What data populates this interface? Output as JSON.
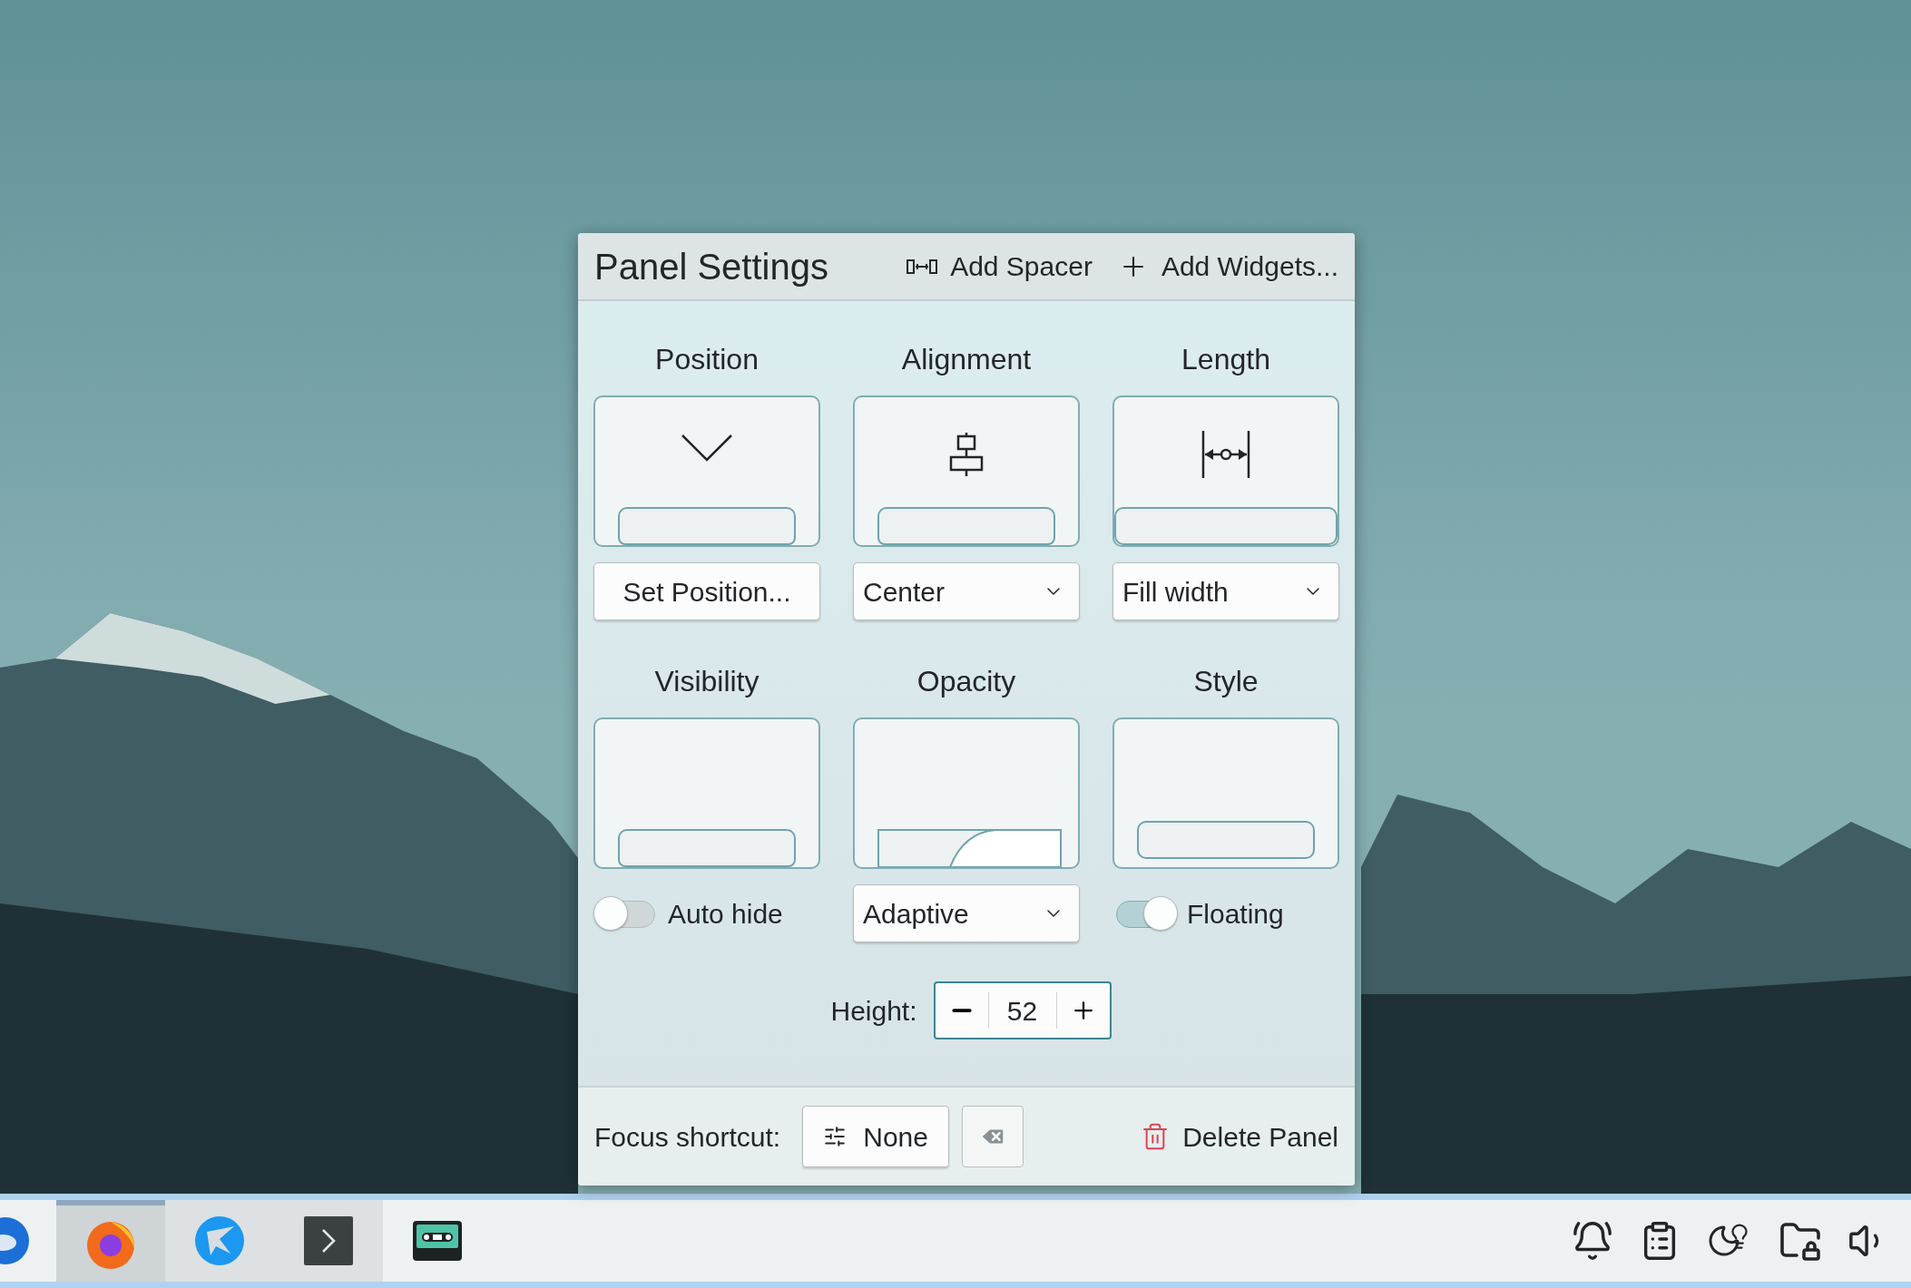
{
  "dialog": {
    "title": "Panel Settings",
    "actions": [
      {
        "kind": "spacer",
        "label": "Add Spacer"
      },
      {
        "kind": "widgets",
        "label": "Add Widgets..."
      }
    ],
    "sections": [
      {
        "label": "Position",
        "kind": "position",
        "control": {
          "kind": "button",
          "text": "Set Position..."
        }
      },
      {
        "label": "Alignment",
        "kind": "alignment",
        "control": {
          "kind": "dropdown",
          "text": "Center"
        }
      },
      {
        "label": "Length",
        "kind": "length",
        "control": {
          "kind": "dropdown",
          "text": "Fill width"
        }
      },
      {
        "label": "Visibility",
        "kind": "visibility",
        "control": {
          "kind": "toggle",
          "text": "Auto hide",
          "on": false
        }
      },
      {
        "label": "Opacity",
        "kind": "opacity",
        "control": {
          "kind": "dropdown",
          "text": "Adaptive"
        }
      },
      {
        "label": "Style",
        "kind": "style",
        "control": {
          "kind": "toggle",
          "text": "Floating",
          "on": true
        }
      }
    ],
    "height": {
      "label": "Height:",
      "value": "52"
    },
    "footer": {
      "label": "Focus shortcut:",
      "shortcut": "None",
      "delete": "Delete Panel"
    }
  },
  "taskbar": {
    "tasks": [
      {
        "kind": "mail",
        "selected": false,
        "running": false
      },
      {
        "kind": "browser",
        "selected": true,
        "running": true
      },
      {
        "kind": "swift",
        "selected": false,
        "running": true
      },
      {
        "kind": "terminal",
        "selected": false,
        "running": true
      },
      {
        "kind": "tape",
        "selected": false,
        "running": false
      }
    ]
  }
}
